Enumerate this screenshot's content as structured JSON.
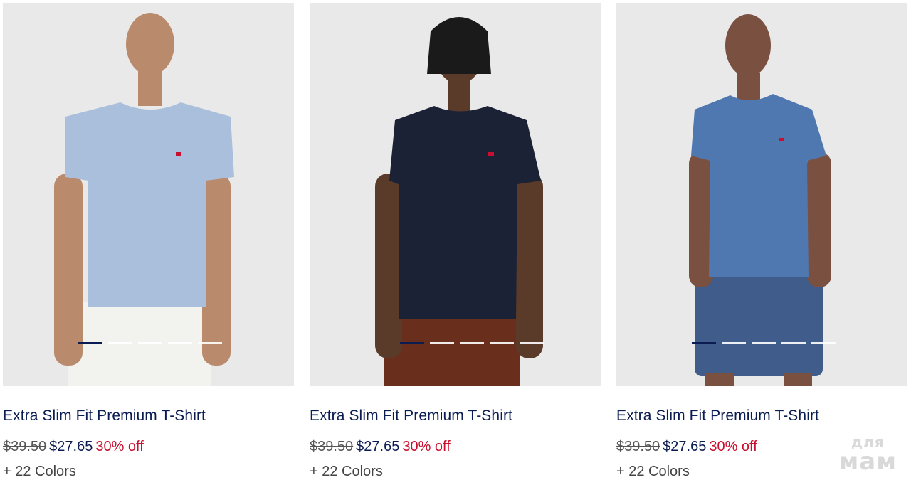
{
  "products": [
    {
      "title": "Extra Slim Fit Premium T-Shirt",
      "old_price": "$39.50",
      "new_price": "$27.65",
      "discount": "30% off",
      "colors": "+ 22 Colors",
      "shirt_color": "#a9bfdc",
      "bottom_color": "#f2f2ee",
      "skin_color": "#b98a6b",
      "image_count": 5,
      "active_image": 1
    },
    {
      "title": "Extra Slim Fit Premium T-Shirt",
      "old_price": "$39.50",
      "new_price": "$27.65",
      "discount": "30% off",
      "colors": "+ 22 Colors",
      "shirt_color": "#1c2236",
      "bottom_color": "#6a2e1c",
      "skin_color": "#5a3a28",
      "image_count": 5,
      "active_image": 1
    },
    {
      "title": "Extra Slim Fit Premium T-Shirt",
      "old_price": "$39.50",
      "new_price": "$27.65",
      "discount": "30% off",
      "colors": "+ 22 Colors",
      "shirt_color": "#4f78b0",
      "bottom_color": "#3f5c8a",
      "skin_color": "#7a5040",
      "image_count": 5,
      "active_image": 1
    }
  ],
  "watermark": {
    "line1": "для",
    "line2": "мам"
  }
}
